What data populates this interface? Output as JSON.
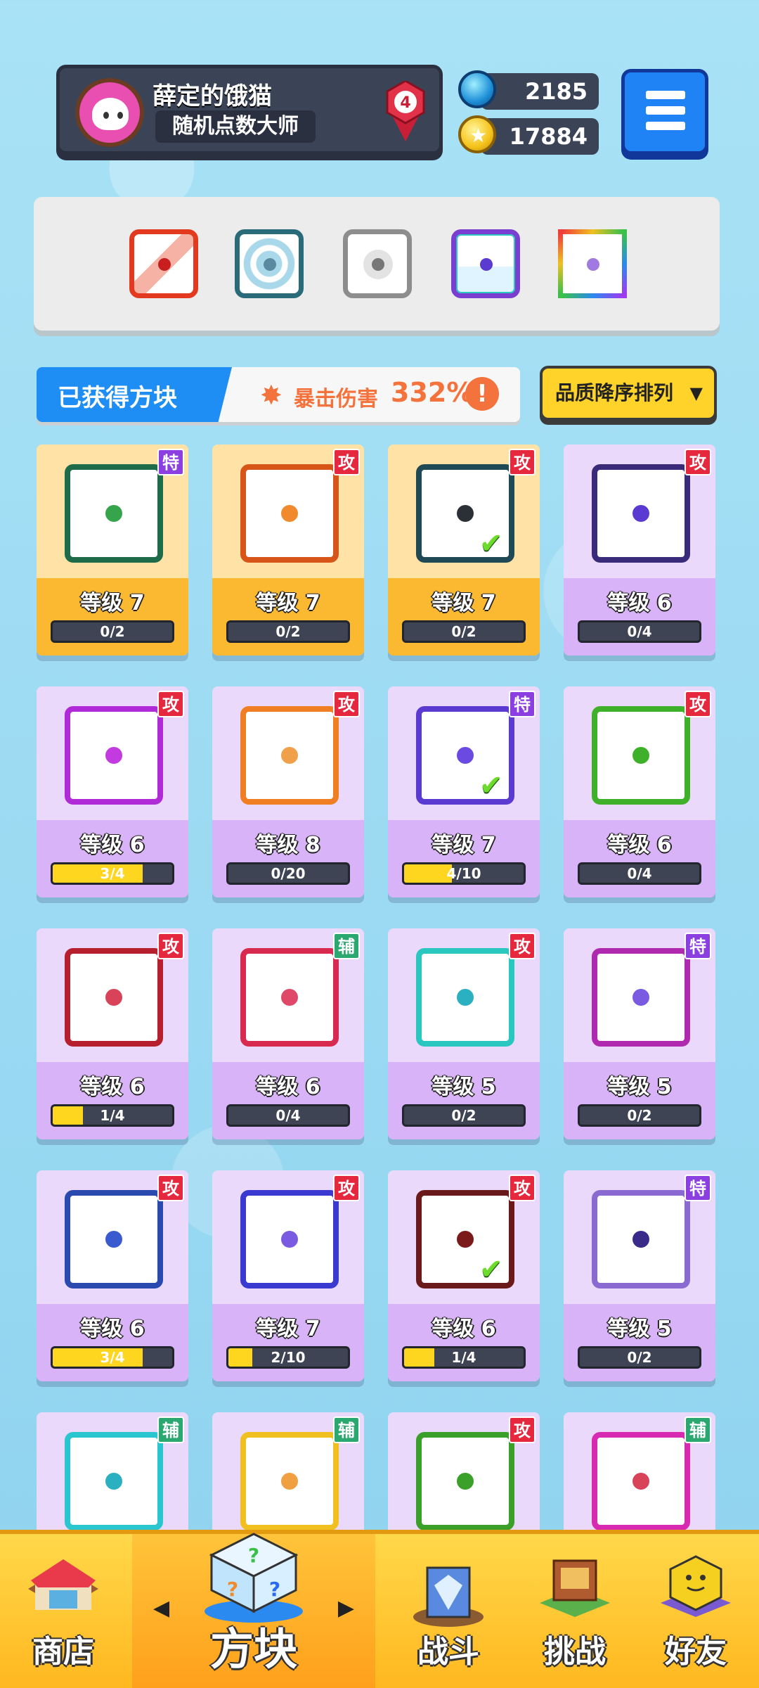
{
  "profile": {
    "name": "薛定的饿猫",
    "title": "随机点数大师",
    "rank": "4"
  },
  "currency": {
    "gems": "2185",
    "coins": "17884"
  },
  "equipped": [
    {
      "name": "fire-dice",
      "color": "#e33a1f"
    },
    {
      "name": "vortex-dice",
      "color": "#2a6b7a"
    },
    {
      "name": "gear-dice",
      "color": "#8d8d8d"
    },
    {
      "name": "heal-dice",
      "color": "#7a3fd0"
    },
    {
      "name": "rainbow-dice",
      "color": "#d63a8a"
    }
  ],
  "section": {
    "title": "已获得方块",
    "crit_label": "暴击伤害",
    "crit_value": "332%",
    "info": "!"
  },
  "sort": {
    "label": "品质降序排列",
    "arrow": "▼"
  },
  "level_prefix": "等级",
  "cards": [
    {
      "tier": "gold",
      "tag": "特",
      "tag_type": "special",
      "level": "等级 7",
      "progress": "0/2",
      "fill": 0,
      "border": "#1e6b4a",
      "pip": "#36a44a",
      "checked": false
    },
    {
      "tier": "gold",
      "tag": "攻",
      "tag_type": "attack",
      "level": "等级 7",
      "progress": "0/2",
      "fill": 0,
      "border": "#d8551a",
      "pip": "#f08a2c",
      "checked": false
    },
    {
      "tier": "gold",
      "tag": "攻",
      "tag_type": "attack",
      "level": "等级 7",
      "progress": "0/2",
      "fill": 0,
      "border": "#1f4a55",
      "pip": "#2a3036",
      "checked": true
    },
    {
      "tier": "purple",
      "tag": "攻",
      "tag_type": "attack",
      "level": "等级 6",
      "progress": "0/4",
      "fill": 0,
      "border": "#3a2a7a",
      "pip": "#5a3ad0",
      "checked": false
    },
    {
      "tier": "purple",
      "tag": "攻",
      "tag_type": "attack",
      "level": "等级 6",
      "progress": "3/4",
      "fill": 0.75,
      "border": "#b02ad8",
      "pip": "#c23ae0",
      "checked": false
    },
    {
      "tier": "purple",
      "tag": "攻",
      "tag_type": "attack",
      "level": "等级 8",
      "progress": "0/20",
      "fill": 0,
      "border": "#f07e22",
      "pip": "#f0a048",
      "checked": false
    },
    {
      "tier": "purple",
      "tag": "特",
      "tag_type": "special",
      "level": "等级 7",
      "progress": "4/10",
      "fill": 0.4,
      "border": "#5a3ad0",
      "pip": "#6a4ae0",
      "checked": true
    },
    {
      "tier": "purple",
      "tag": "攻",
      "tag_type": "attack",
      "level": "等级 6",
      "progress": "0/4",
      "fill": 0,
      "border": "#3fb02a",
      "pip": "#3fb02a",
      "checked": false
    },
    {
      "tier": "purple",
      "tag": "攻",
      "tag_type": "attack",
      "level": "等级 6",
      "progress": "1/4",
      "fill": 0.25,
      "border": "#b51f2e",
      "pip": "#d8435a",
      "checked": false
    },
    {
      "tier": "purple",
      "tag": "辅",
      "tag_type": "support",
      "level": "等级 6",
      "progress": "0/4",
      "fill": 0,
      "border": "#d8294e",
      "pip": "#e0486a",
      "checked": false
    },
    {
      "tier": "purple",
      "tag": "攻",
      "tag_type": "attack",
      "level": "等级 5",
      "progress": "0/2",
      "fill": 0,
      "border": "#2ac6c0",
      "pip": "#2ab0c0",
      "checked": false
    },
    {
      "tier": "purple",
      "tag": "特",
      "tag_type": "special",
      "level": "等级 5",
      "progress": "0/2",
      "fill": 0,
      "border": "#b02ab0",
      "pip": "#7a5ae0",
      "checked": false
    },
    {
      "tier": "purple",
      "tag": "攻",
      "tag_type": "attack",
      "level": "等级 6",
      "progress": "3/4",
      "fill": 0.75,
      "border": "#2a4ab0",
      "pip": "#3a5ad0",
      "checked": false
    },
    {
      "tier": "purple",
      "tag": "攻",
      "tag_type": "attack",
      "level": "等级 7",
      "progress": "2/10",
      "fill": 0.2,
      "border": "#3a3ad0",
      "pip": "#7a5ae0",
      "checked": false
    },
    {
      "tier": "purple",
      "tag": "攻",
      "tag_type": "attack",
      "level": "等级 6",
      "progress": "1/4",
      "fill": 0.25,
      "border": "#6a1a1a",
      "pip": "#7a1a1a",
      "checked": true
    },
    {
      "tier": "purple",
      "tag": "特",
      "tag_type": "special",
      "level": "等级 5",
      "progress": "0/2",
      "fill": 0,
      "border": "#8a6ad0",
      "pip": "#3a2a8a",
      "checked": false
    },
    {
      "tier": "purple",
      "tag": "辅",
      "tag_type": "support",
      "level": "",
      "progress": "",
      "fill": 0,
      "border": "#2ac6d0",
      "pip": "#2ab0c0",
      "checked": false
    },
    {
      "tier": "purple",
      "tag": "辅",
      "tag_type": "support",
      "level": "",
      "progress": "",
      "fill": 0,
      "border": "#f0c020",
      "pip": "#f0a040",
      "checked": false
    },
    {
      "tier": "purple",
      "tag": "攻",
      "tag_type": "attack",
      "level": "",
      "progress": "",
      "fill": 0,
      "border": "#3aa02a",
      "pip": "#3aa02a",
      "checked": false
    },
    {
      "tier": "purple",
      "tag": "辅",
      "tag_type": "support",
      "level": "",
      "progress": "",
      "fill": 0,
      "border": "#d82ab0",
      "pip": "#d8435a",
      "checked": false
    }
  ],
  "nav": {
    "shop": "商店",
    "dice": "方块",
    "battle": "战斗",
    "challenge": "挑战",
    "friends": "好友",
    "left_arrow": "◀",
    "right_arrow": "▶"
  }
}
